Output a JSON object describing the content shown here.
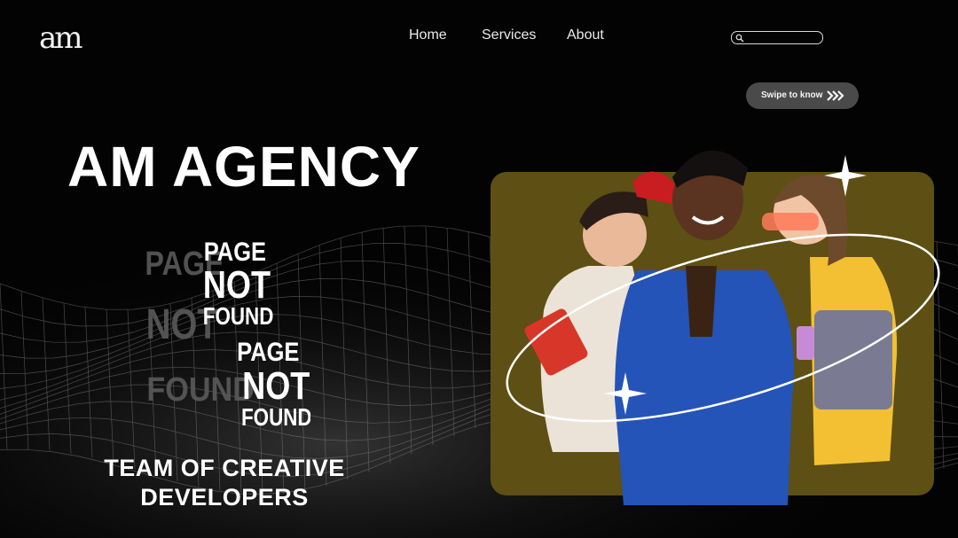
{
  "brand": {
    "logo_text": "am"
  },
  "nav": {
    "items": [
      "Home",
      "Services",
      "About"
    ]
  },
  "search": {
    "placeholder": ""
  },
  "swipe_button": {
    "label": "Swipe to know"
  },
  "hero": {
    "title": "AM AGENCY",
    "tagline": "TEAM OF CREATIVE DEVELOPERS",
    "art_text": [
      "PAGE",
      "NOT",
      "FOUND"
    ]
  },
  "colors": {
    "background": "#030303",
    "photo_backdrop": "#6b5a17",
    "swipe_button_bg": "#4a4a4a",
    "text": "#ffffff"
  },
  "icons": [
    "search-icon",
    "chevron-right-icon",
    "sparkle-icon"
  ]
}
